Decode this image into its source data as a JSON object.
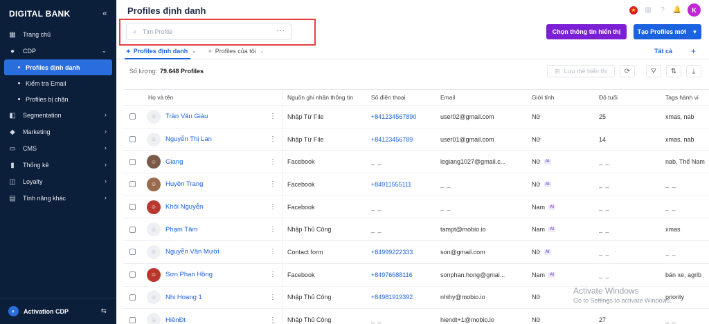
{
  "sidebar": {
    "brand": "DIGITAL BANK",
    "collapse_glyph": "«",
    "items": [
      {
        "label": "Trang chủ",
        "icon": "grid-icon",
        "glyph": "▦"
      },
      {
        "label": "CDP",
        "icon": "user-icon",
        "glyph": "●",
        "chevron": "⌄"
      },
      {
        "label": "Segmentation",
        "icon": "layers-icon",
        "glyph": "◧",
        "chevron": "›"
      },
      {
        "label": "Marketing",
        "icon": "megaphone-icon",
        "glyph": "◆",
        "chevron": "›"
      },
      {
        "label": "CMS",
        "icon": "monitor-icon",
        "glyph": "▭",
        "chevron": "›"
      },
      {
        "label": "Thống kê",
        "icon": "chart-icon",
        "glyph": "▮",
        "chevron": "›"
      },
      {
        "label": "Loyalty",
        "icon": "gift-icon",
        "glyph": "◫",
        "chevron": "›"
      },
      {
        "label": "Tính năng khác",
        "icon": "apps-icon",
        "glyph": "▤",
        "chevron": "›"
      }
    ],
    "cdp_subitems": [
      {
        "label": "Profiles định danh",
        "active": true
      },
      {
        "label": "Kiểm tra Email",
        "active": false
      },
      {
        "label": "Profiles bị chặn",
        "active": false
      }
    ],
    "footer": {
      "label": "Activation CDP",
      "switch_glyph": "⇆"
    }
  },
  "header": {
    "title": "Profiles định danh",
    "avatar_initial": "K",
    "flag_glyph": "★",
    "icon_glyphs": {
      "book": "▥",
      "help": "?",
      "bell": "🔔"
    }
  },
  "search": {
    "placeholder": "Tìm Profile",
    "more_glyph": "···"
  },
  "buttons": {
    "choose_display": "Chọn thông tin hiển thị",
    "create_profile": "Tạo Profiles mới",
    "create_caret": "▼"
  },
  "tabs": [
    {
      "label": "Profiles định danh",
      "icon": "pin-icon",
      "glyph": "✦",
      "caret": "⌄",
      "active": true
    },
    {
      "label": "Profiles của tôi",
      "icon": "pin-icon",
      "glyph": "✧",
      "caret": "⌄",
      "active": false
    }
  ],
  "tabs_right": {
    "all": "Tất cả",
    "plus": "+"
  },
  "toolbar": {
    "count_label": "Số lượng:",
    "count_value": "79.648 Profiles",
    "save_view": "Lưu thẻ hiển thị",
    "save_glyph": "⊟",
    "glyphs": {
      "refresh": "⟳",
      "filter": "⛛",
      "sort": "⇅",
      "download": "⤓"
    }
  },
  "colors": {
    "sidebar_bg": "#0b1e3a",
    "active_blue": "#1a62e0",
    "purple": "#7b1fd6",
    "highlight": "#e63d3d"
  },
  "table": {
    "columns": [
      "Họ và tên",
      "Nguồn ghi nhận thông tin",
      "Số điện thoại",
      "Email",
      "Giới tính",
      "Độ tuổi",
      "Tags hành vi"
    ],
    "kebab": "⋮",
    "ai_badge": "AI",
    "rows": [
      {
        "name": "Trần Văn Giàu",
        "source": "Nhập Từ File",
        "phone": "+841234567890",
        "email": "user02@gmail.com",
        "gender": "Nữ",
        "ai": false,
        "age": "25",
        "tags": "xmas, nab",
        "avatar": "default"
      },
      {
        "name": "Nguyễn Thị Lan",
        "source": "Nhập Từ File",
        "phone": "+84123456789",
        "email": "user01@gmail.com",
        "gender": "Nữ",
        "ai": false,
        "age": "14",
        "tags": "xmas, nab",
        "avatar": "default"
      },
      {
        "name": "Giang",
        "source": "Facebook",
        "phone": "_ _",
        "email": "legiang1027@gmail.c...",
        "gender": "Nữ",
        "ai": true,
        "age": "_ _",
        "tags": "nab, Thế Nam",
        "avatar": "photo"
      },
      {
        "name": "Huyền Trang",
        "source": "Facebook",
        "phone": "+84911555111",
        "email": "_ _",
        "gender": "Nữ",
        "ai": true,
        "age": "_ _",
        "tags": "_ _",
        "avatar": "photo3"
      },
      {
        "name": "Khôi Nguyễn",
        "source": "Facebook",
        "phone": "_ _",
        "email": "_ _",
        "gender": "Nam",
        "ai": true,
        "age": "_ _",
        "tags": "_ _",
        "avatar": "photo2"
      },
      {
        "name": "Phạm Tâm",
        "source": "Nhập Thủ Công",
        "phone": "_ _",
        "email": "tampt@mobio.io",
        "gender": "Nam",
        "ai": true,
        "age": "_ _",
        "tags": "xmas",
        "avatar": "default"
      },
      {
        "name": "Nguyễn Văn Mười",
        "source": "Contact form",
        "phone": "+84999222333",
        "email": "son@gmail.com",
        "gender": "Nữ",
        "ai": true,
        "age": "_ _",
        "tags": "_ _",
        "avatar": "default"
      },
      {
        "name": "Sơn Phan Hồng",
        "source": "Facebook",
        "phone": "+84976688116",
        "email": "sonphan.hong@gmai...",
        "gender": "Nam",
        "ai": true,
        "age": "_ _",
        "tags": "bán xe, agrib",
        "avatar": "photo2"
      },
      {
        "name": "Nhi Hoang 1",
        "source": "Nhập Thủ Công",
        "phone": "+84981919392",
        "email": "nhihy@mobio.io",
        "gender": "Nữ",
        "ai": false,
        "age": "_ _",
        "tags": "priority",
        "avatar": "default"
      },
      {
        "name": "HiềnĐt",
        "source": "Nhập Thủ Công",
        "phone": "_ _",
        "email": "hiendt+1@mobio.io",
        "gender": "Nữ",
        "ai": false,
        "age": "27",
        "tags": "_ _",
        "avatar": "default"
      }
    ]
  },
  "watermark": {
    "line1": "Activate Windows",
    "line2": "Go to Settings to activate Windows."
  }
}
